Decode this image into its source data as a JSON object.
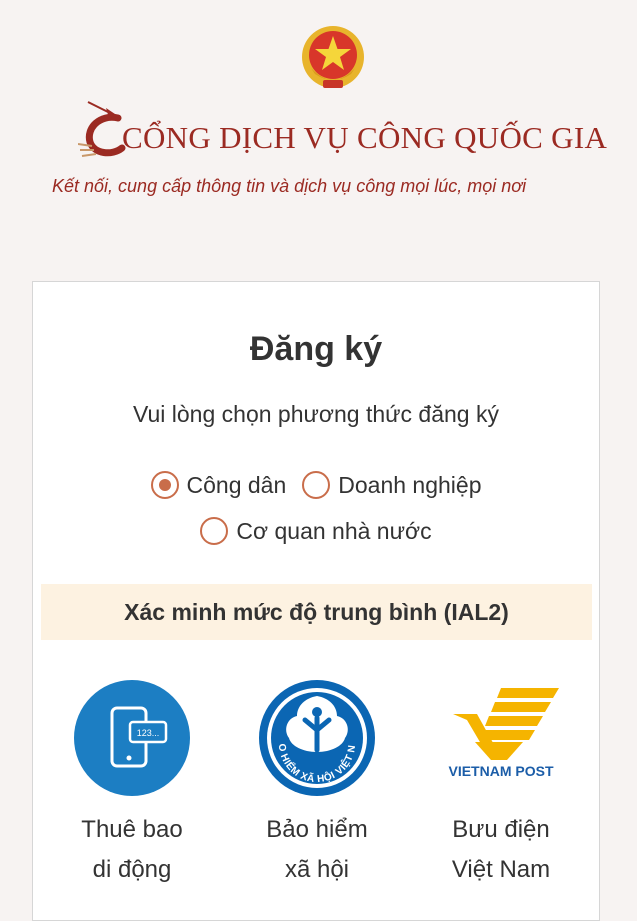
{
  "header": {
    "title": "CỔNG DỊCH VỤ CÔNG QUỐC GIA",
    "slogan": "Kết nối, cung cấp thông tin và dịch vụ công mọi lúc, mọi nơi"
  },
  "register": {
    "title": "Đăng ký",
    "subtitle": "Vui lòng chọn phương thức đăng ký",
    "account_types": [
      {
        "label": "Công dân",
        "selected": true
      },
      {
        "label": "Doanh nghiệp",
        "selected": false
      },
      {
        "label": "Cơ quan nhà nước",
        "selected": false
      }
    ],
    "verification_level": "Xác minh mức độ trung bình (IAL2)",
    "methods": [
      {
        "line1": "Thuê bao",
        "line2": "di động",
        "icon": "mobile-subscriber-icon"
      },
      {
        "line1": "Bảo hiểm",
        "line2": "xã hội",
        "icon": "social-insurance-logo",
        "logo_text": "BẢO HIỂM XÃ HỘI VIỆT NAM"
      },
      {
        "line1": "Bưu điện",
        "line2": "Việt Nam",
        "icon": "vietnam-post-logo",
        "logo_text": "VIETNAM POST"
      }
    ],
    "phone_screen_text": "123..."
  },
  "colors": {
    "brand_red": "#9b2a22",
    "accent": "#c96d4a",
    "band_bg": "#fdf2e1",
    "mobile_blue": "#1c7ec3",
    "bhxh_blue": "#0b66b3",
    "post_yellow": "#f5b400",
    "post_blue": "#1b5da8"
  }
}
